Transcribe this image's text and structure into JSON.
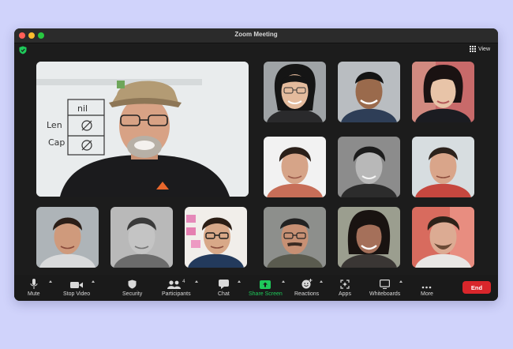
{
  "window": {
    "title": "Zoom Meeting"
  },
  "header": {
    "view_label": "View"
  },
  "toolbar": {
    "mute_label": "Mute",
    "video_label": "Stop Video",
    "security_label": "Security",
    "participants_label": "Participants",
    "participants_count": "4",
    "chat_label": "Chat",
    "share_label": "Share Screen",
    "reactions_label": "Reactions",
    "apps_label": "Apps",
    "whiteboards_label": "Whiteboards",
    "more_label": "More",
    "end_label": "End"
  },
  "whiteboard": {
    "row1": "nil",
    "row2": "Len",
    "row3": "Cap",
    "cell1": "Ø",
    "cell2": "Ø"
  },
  "colors": {
    "accent_green": "#1ec95a",
    "end_red": "#d9262b",
    "page_bg": "#d0d3fb"
  }
}
